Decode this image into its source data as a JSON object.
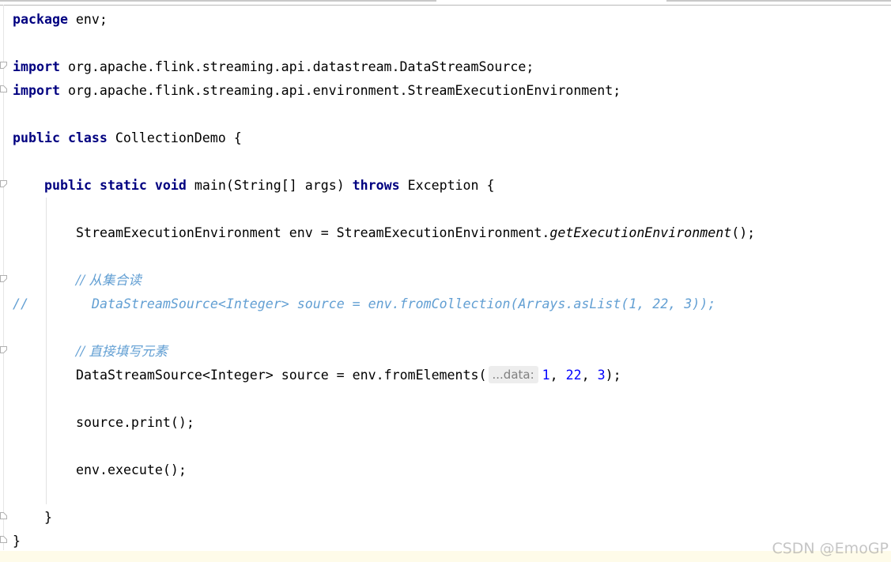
{
  "editor": {
    "lines": {
      "package_kw": "package",
      "package_name": " env;",
      "import_kw": "import",
      "import1_path": " org.apache.flink.streaming.api.datastream.DataStreamSource;",
      "import2_path": " org.apache.flink.streaming.api.environment.StreamExecutionEnvironment;",
      "class_kw1": "public",
      "class_kw2": "class",
      "class_rest": " CollectionDemo {",
      "main_kw1": "public",
      "main_kw2": "static",
      "main_kw3": "void",
      "main_sig": " main(String[] args) ",
      "main_throws": "throws",
      "main_rest": " Exception {",
      "env_decl_start": "StreamExecutionEnvironment env = StreamExecutionEnvironment.",
      "env_decl_method": "getExecutionEnvironment",
      "env_decl_end": "();",
      "comment_collection": "// 从集合读",
      "commented_prefix": "//",
      "commented_code": "DataStreamSource<Integer> source = env.fromCollection(Arrays.asList(1, 22, 3));",
      "comment_elements": "// 直接填写元素",
      "source_decl_start": "DataStreamSource<Integer> source = env.fromElements(",
      "param_hint": "...data:",
      "arg1": "1",
      "arg_sep1": ", ",
      "arg2": "22",
      "arg_sep2": ", ",
      "arg3": "3",
      "source_decl_end": ");",
      "print_stmt": "source.print();",
      "execute_stmt": "env.execute();",
      "close_method": "}",
      "close_class": "}"
    }
  },
  "watermark": "CSDN @EmoGP",
  "colors": {
    "keyword": "#000080",
    "comment": "#629fd3",
    "number": "#0000ff",
    "hint_bg": "#ededed"
  }
}
